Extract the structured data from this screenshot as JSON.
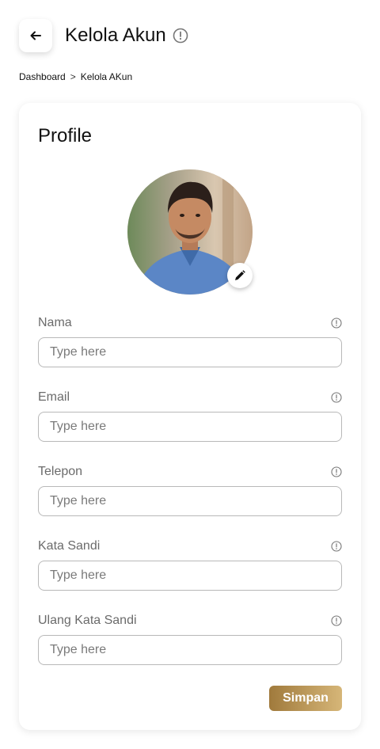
{
  "header": {
    "title": "Kelola Akun",
    "back_icon": "arrow-left-icon",
    "info_icon": "info-circle-icon"
  },
  "breadcrumb": {
    "items": [
      "Dashboard",
      "Kelola AKun"
    ],
    "separator": ">"
  },
  "profile": {
    "title": "Profile",
    "avatar_alt": "profile photo",
    "edit_icon": "pencil-icon"
  },
  "form": {
    "fields": [
      {
        "label": "Nama",
        "placeholder": "Type here",
        "value": ""
      },
      {
        "label": "Email",
        "placeholder": "Type here",
        "value": ""
      },
      {
        "label": "Telepon",
        "placeholder": "Type here",
        "value": ""
      },
      {
        "label": "Kata Sandi",
        "placeholder": "Type here",
        "value": ""
      },
      {
        "label": "Ulang Kata Sandi",
        "placeholder": "Type here",
        "value": ""
      }
    ],
    "save_label": "Simpan"
  },
  "colors": {
    "accent_start": "#a07a3c",
    "accent_end": "#d6b678",
    "border": "#b8b8b8"
  }
}
